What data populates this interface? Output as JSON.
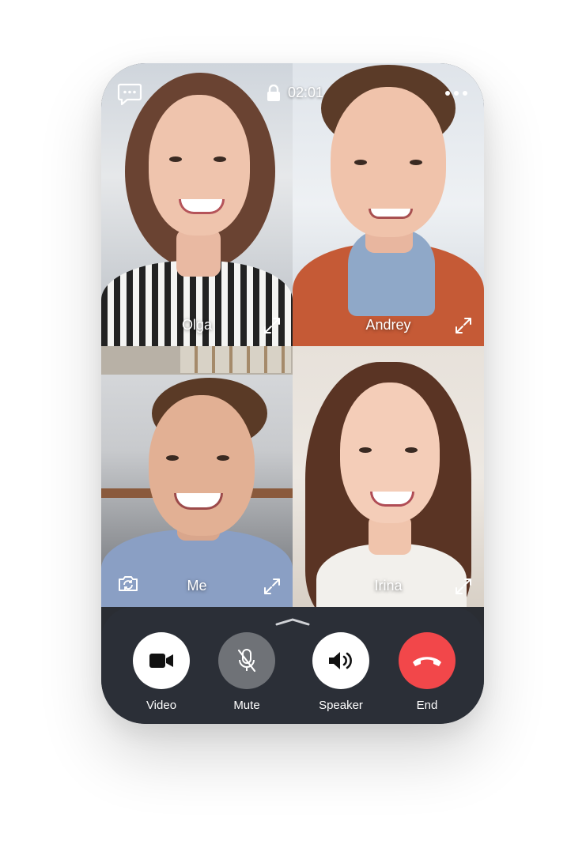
{
  "status_bar": {
    "timer": "02:01",
    "icons": [
      "chat-icon",
      "lock-icon",
      "more-icon"
    ]
  },
  "participants": [
    {
      "name": "Olga"
    },
    {
      "name": "Andrey"
    },
    {
      "name": "Me"
    },
    {
      "name": "Irina"
    }
  ],
  "controls": {
    "video_label": "Video",
    "mute_label": "Mute",
    "speaker_label": "Speaker",
    "end_label": "End"
  },
  "colors": {
    "end_call": "#f2474a",
    "control_bar": "#2c3037",
    "mute_button": "#6f7277"
  }
}
